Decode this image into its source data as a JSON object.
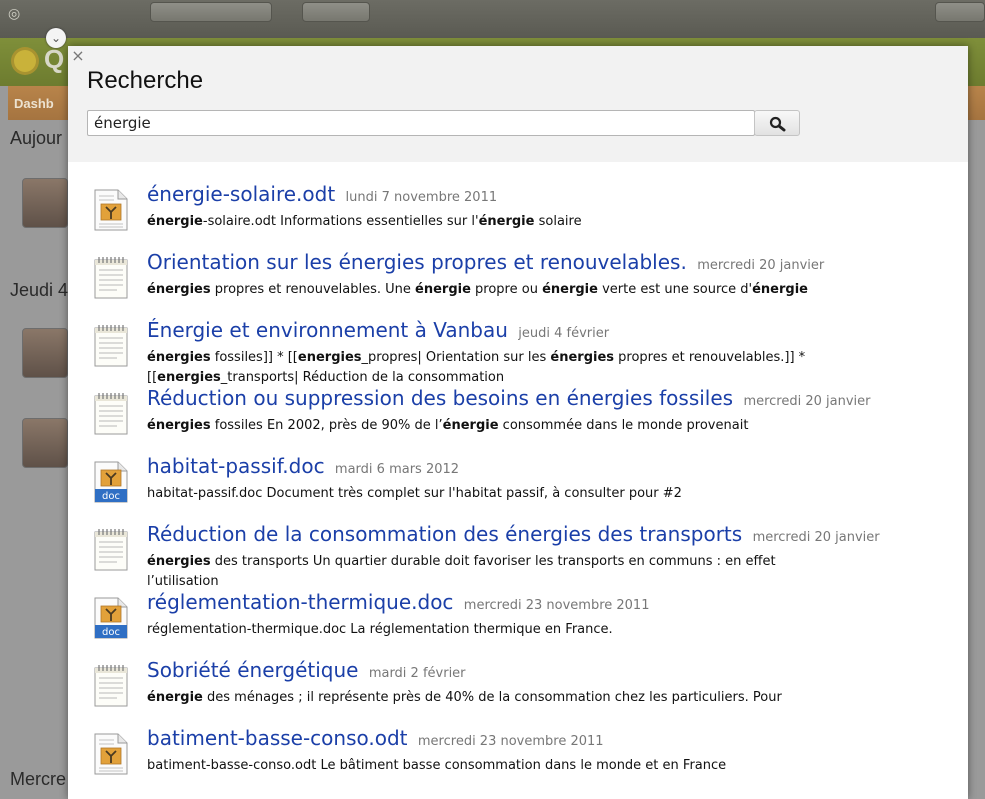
{
  "background": {
    "tab_label": "Dashb",
    "days": [
      "Aujour",
      "Jeudi 4",
      "Mercre"
    ]
  },
  "dialog": {
    "close_label": "×",
    "title": "Recherche",
    "search": {
      "value": "énergie",
      "button_icon": "search-icon"
    }
  },
  "results": [
    {
      "title": "énergie-solaire.odt",
      "date": "lundi 7 novembre 2011",
      "type": "odt",
      "snippet": [
        {
          "b": true,
          "t": "énergie"
        },
        {
          "b": false,
          "t": "-solaire.odt Informations essentielles sur l'"
        },
        {
          "b": true,
          "t": "énergie"
        },
        {
          "b": false,
          "t": " solaire"
        }
      ]
    },
    {
      "title": "Orientation sur les énergies propres et renouvelables.",
      "date": "mercredi 20 janvier",
      "type": "wiki",
      "snippet": [
        {
          "b": true,
          "t": "énergies"
        },
        {
          "b": false,
          "t": " propres et renouvelables. Une "
        },
        {
          "b": true,
          "t": "énergie"
        },
        {
          "b": false,
          "t": " propre ou "
        },
        {
          "b": true,
          "t": "énergie"
        },
        {
          "b": false,
          "t": " verte est une source d'"
        },
        {
          "b": true,
          "t": "énergie"
        }
      ]
    },
    {
      "title": "Énergie et environnement à Vanbau",
      "date": "jeudi 4 février",
      "type": "wiki",
      "snippet": [
        {
          "b": true,
          "t": "énergies"
        },
        {
          "b": false,
          "t": " fossiles]] * [["
        },
        {
          "b": true,
          "t": "energies"
        },
        {
          "b": false,
          "t": "_propres| Orientation sur les "
        },
        {
          "b": true,
          "t": "énergies"
        },
        {
          "b": false,
          "t": " propres et renouvelables.]] * [["
        },
        {
          "b": true,
          "t": "energies"
        },
        {
          "b": false,
          "t": "_transports| Réduction de la consommation"
        }
      ]
    },
    {
      "title": "Réduction ou suppression des besoins en énergies fossiles",
      "date": "mercredi 20 janvier",
      "type": "wiki",
      "snippet": [
        {
          "b": true,
          "t": "énergies"
        },
        {
          "b": false,
          "t": " fossiles En 2002, près de 90% de l’"
        },
        {
          "b": true,
          "t": "énergie"
        },
        {
          "b": false,
          "t": " consommée dans le monde provenait"
        }
      ]
    },
    {
      "title": "habitat-passif.doc",
      "date": "mardi 6 mars 2012",
      "type": "doc",
      "snippet": [
        {
          "b": false,
          "t": "habitat-passif.doc Document très complet sur l'habitat passif, à consulter pour #2"
        }
      ]
    },
    {
      "title": "Réduction de la consommation des énergies des transports",
      "date": "mercredi 20 janvier",
      "type": "wiki",
      "snippet": [
        {
          "b": true,
          "t": "énergies"
        },
        {
          "b": false,
          "t": " des transports Un quartier durable doit favoriser les transports en communs : en effet l’utilisation"
        }
      ]
    },
    {
      "title": "réglementation-thermique.doc",
      "date": "mercredi 23 novembre 2011",
      "type": "doc",
      "snippet": [
        {
          "b": false,
          "t": "réglementation-thermique.doc La réglementation thermique en France."
        }
      ]
    },
    {
      "title": "Sobriété énergétique",
      "date": "mardi 2 février",
      "type": "wiki",
      "snippet": [
        {
          "b": true,
          "t": "énergie"
        },
        {
          "b": false,
          "t": " des ménages ; il représente près de 40% de la consommation chez les particuliers. Pour"
        }
      ]
    },
    {
      "title": "batiment-basse-conso.odt",
      "date": "mercredi 23 novembre 2011",
      "type": "odt",
      "snippet": [
        {
          "b": false,
          "t": "batiment-basse-conso.odt Le bâtiment basse consommation dans le monde et en France"
        }
      ]
    }
  ],
  "colors": {
    "link": "#1b3fa8",
    "date": "#777777",
    "header_bg": "#f2f2f2"
  }
}
